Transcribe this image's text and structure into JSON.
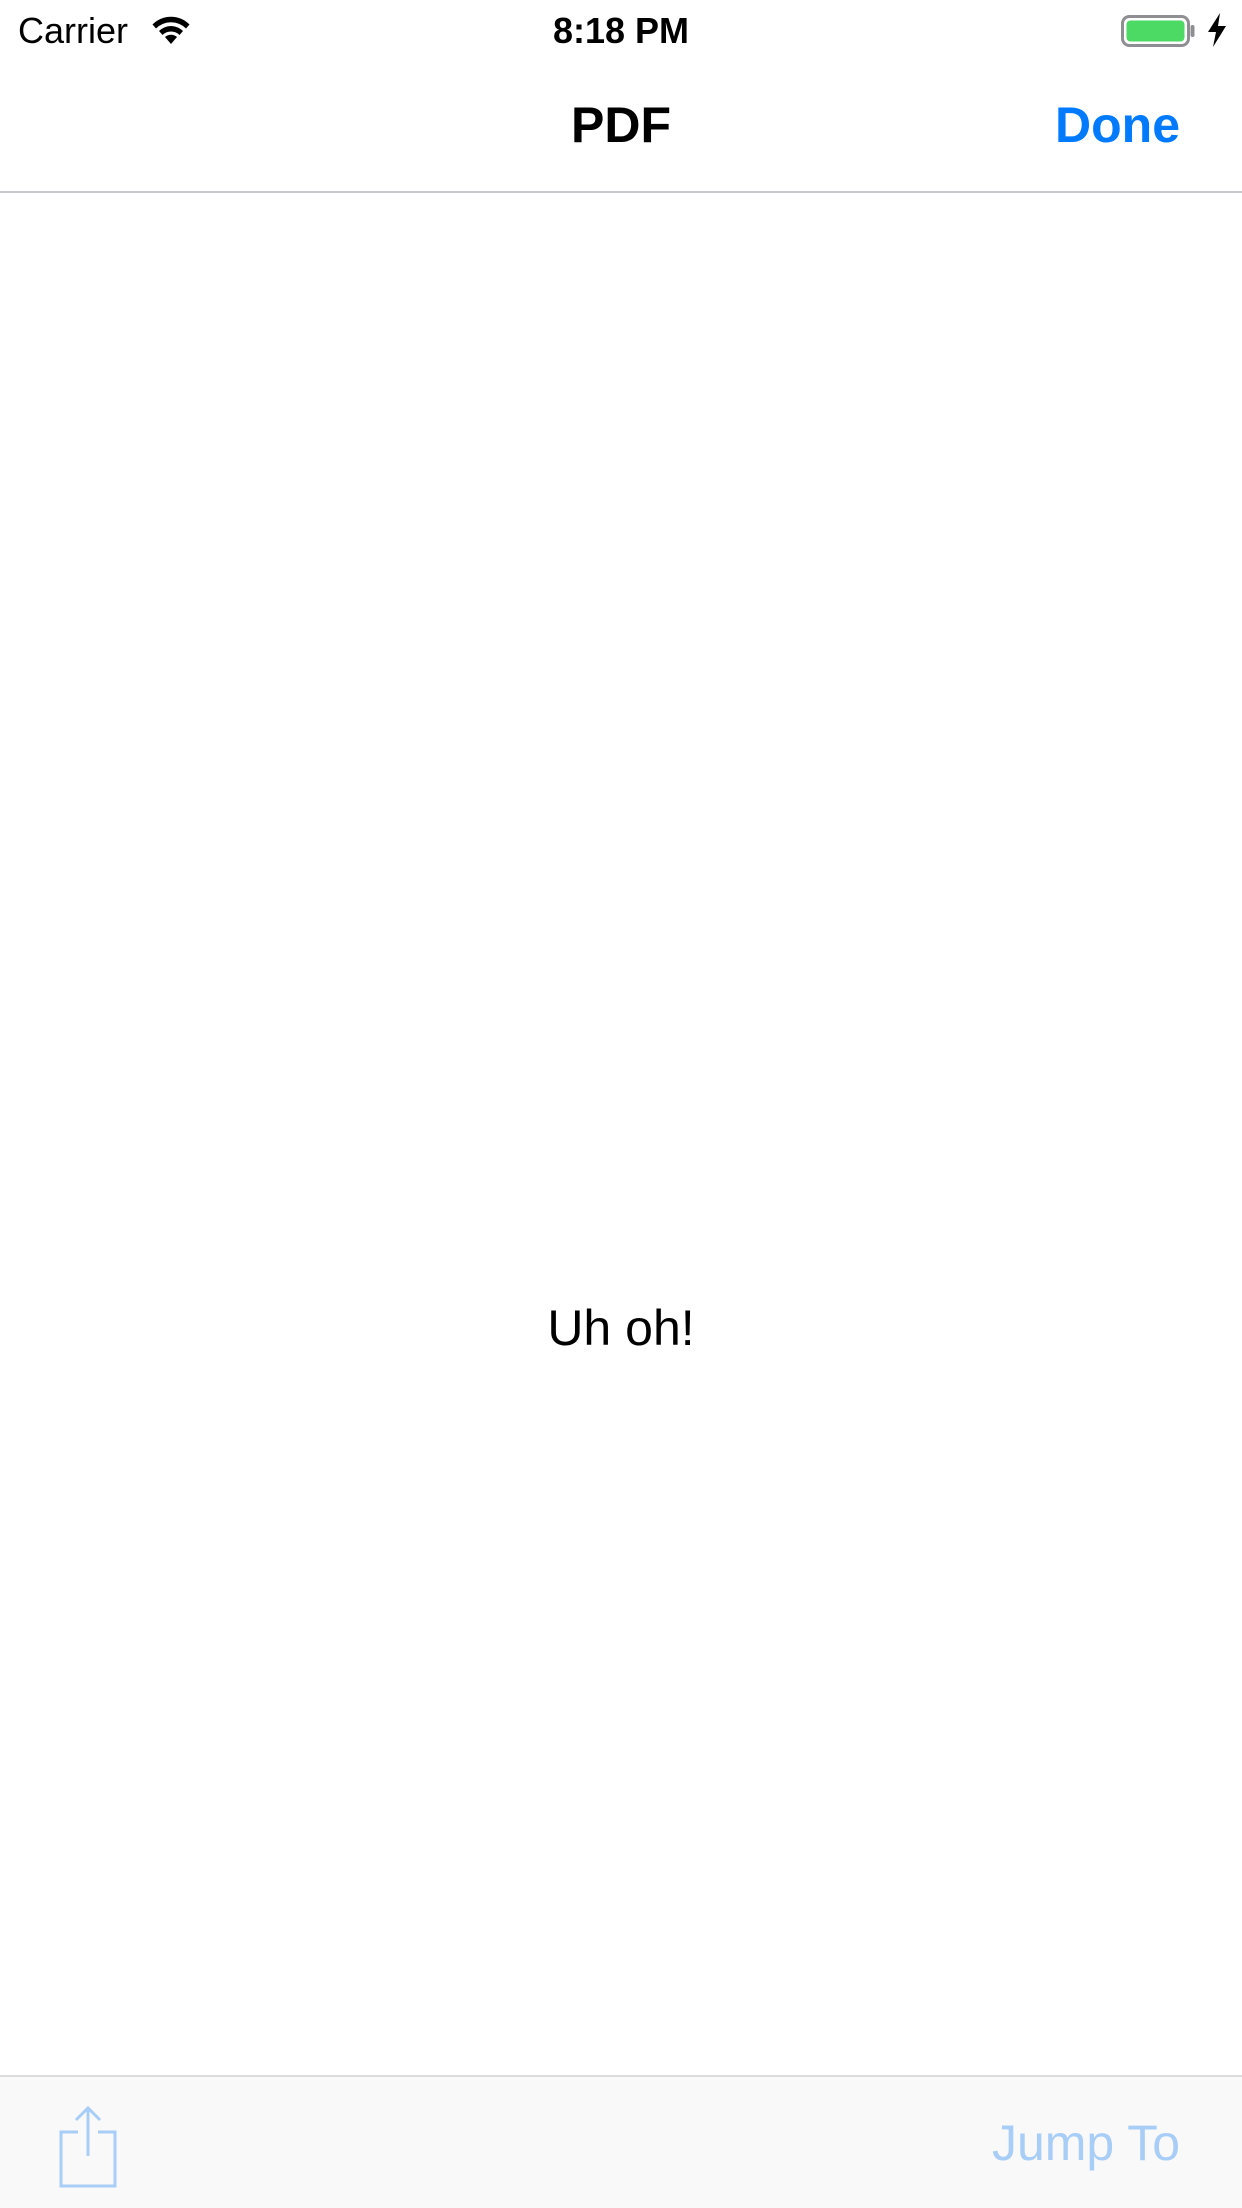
{
  "status_bar": {
    "carrier": "Carrier",
    "time": "8:18 PM",
    "wifi_icon": "wifi-icon",
    "battery_icon": "battery-icon",
    "charging_icon": "bolt-icon",
    "battery_color": "#4cd964"
  },
  "nav": {
    "title": "PDF",
    "done_label": "Done",
    "accent_color": "#007aff"
  },
  "content": {
    "message": "Uh oh!"
  },
  "toolbar": {
    "share_icon": "share-icon",
    "jump_to_label": "Jump To",
    "disabled_color": "#a8cdf7"
  }
}
